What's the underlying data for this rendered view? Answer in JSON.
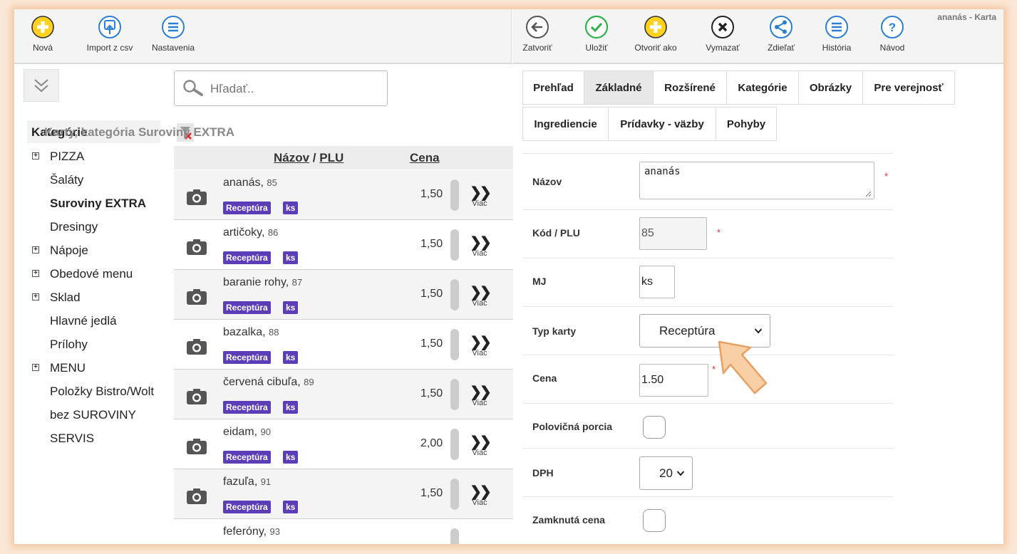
{
  "window_title": "ananás - Karta",
  "toolbar_left": [
    {
      "label": "Nová",
      "icon": "plus-circle-icon"
    },
    {
      "label": "Import z csv",
      "icon": "upload-icon"
    },
    {
      "label": "Nastavenia",
      "icon": "menu-lines-icon"
    }
  ],
  "toolbar_right": [
    {
      "label": "Zatvoriť",
      "icon": "arrow-left-icon"
    },
    {
      "label": "Uložiť",
      "icon": "check-icon"
    },
    {
      "label": "Otvoriť ako",
      "icon": "plus-circle-icon"
    },
    {
      "label": "Vymazať",
      "icon": "close-icon"
    },
    {
      "label": "Zdieľať",
      "icon": "share-icon"
    },
    {
      "label": "História",
      "icon": "menu-lines-icon"
    },
    {
      "label": "Návod",
      "icon": "question-icon"
    }
  ],
  "sidebar": {
    "heading": "Kategórie",
    "items": [
      {
        "label": "PIZZA",
        "expandable": true
      },
      {
        "label": "Šaláty",
        "expandable": false
      },
      {
        "label": "Suroviny EXTRA",
        "expandable": false,
        "active": true
      },
      {
        "label": "Dresingy",
        "expandable": false
      },
      {
        "label": "Nápoje",
        "expandable": true
      },
      {
        "label": "Obedové menu",
        "expandable": true
      },
      {
        "label": "Sklad",
        "expandable": true
      },
      {
        "label": "Hlavné jedlá",
        "expandable": false
      },
      {
        "label": "Prílohy",
        "expandable": false
      },
      {
        "label": "MENU",
        "expandable": true
      },
      {
        "label": "Položky Bistro/Wolt",
        "expandable": false
      },
      {
        "label": "bez SUROVINY",
        "expandable": false
      },
      {
        "label": "SERVIS",
        "expandable": false
      }
    ]
  },
  "search": {
    "placeholder": "Hľadať.."
  },
  "list": {
    "title": "Karty, kategória Suroviny EXTRA",
    "col_name": "Názov",
    "col_sep": " / ",
    "col_plu": "PLU",
    "col_price": "Cena",
    "more_label": "Viac",
    "badge_type": "Receptúra",
    "badge_unit": "ks",
    "rows": [
      {
        "name": "ananás",
        "plu": "85",
        "price": "1,50"
      },
      {
        "name": "artičoky",
        "plu": "86",
        "price": "1,50"
      },
      {
        "name": "baranie rohy",
        "plu": "87",
        "price": "1,50"
      },
      {
        "name": "bazalka",
        "plu": "88",
        "price": "1,50"
      },
      {
        "name": "červená cibuľa",
        "plu": "89",
        "price": "1,50"
      },
      {
        "name": "eidam",
        "plu": "90",
        "price": "2,00"
      },
      {
        "name": "fazuľa",
        "plu": "91",
        "price": "1,50"
      },
      {
        "name": "feferóny",
        "plu": "93",
        "price": ""
      }
    ]
  },
  "tabs": [
    {
      "label": "Prehľad"
    },
    {
      "label": "Základné",
      "active": true
    },
    {
      "label": "Rozšírené"
    },
    {
      "label": "Kategórie"
    },
    {
      "label": "Obrázky"
    },
    {
      "label": "Pre verejnosť"
    },
    {
      "label": "Ingrediencie"
    },
    {
      "label": "Prídavky - väzby"
    },
    {
      "label": "Pohyby"
    }
  ],
  "form": {
    "name_label": "Názov",
    "name_value": "ananás",
    "code_label": "Kód / PLU",
    "code_value": "85",
    "unit_label": "MJ",
    "unit_value": "ks",
    "type_label": "Typ karty",
    "type_value": "Receptúra",
    "price_label": "Cena",
    "price_value": "1.50",
    "half_label": "Polovičná porcia",
    "vat_label": "DPH",
    "vat_value": "20",
    "locked_label": "Zamknutá cena",
    "required_mark": "*"
  },
  "colors": {
    "accent_badge": "#5b3db8",
    "yellow_icon": "#ffd21f",
    "blue_icon": "#2a7fd4",
    "green_icon": "#2db24a",
    "pointer": "#f5b27a"
  }
}
